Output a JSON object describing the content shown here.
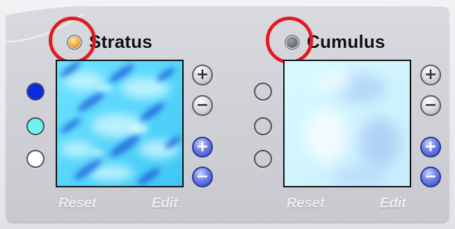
{
  "panels": [
    {
      "title": "Stratus",
      "status_led": {
        "state": "on",
        "color": "#f2a93b"
      },
      "highlighted": true,
      "preview": {
        "texture": "blue-stratus-clouds"
      },
      "swatches": [
        {
          "color": "#0a2be0"
        },
        {
          "color": "#6ff2ee"
        },
        {
          "color": "#ffffff"
        }
      ],
      "buttons": {
        "plus_top": "+",
        "minus_top": "−",
        "plus_bottom": "+",
        "minus_bottom": "−"
      },
      "links": {
        "reset": "Reset",
        "edit": "Edit"
      }
    },
    {
      "title": "Cumulus",
      "status_led": {
        "state": "off",
        "color": "#6f727a"
      },
      "highlighted": true,
      "preview": {
        "texture": "pale-cumulus-clouds"
      },
      "swatches": [
        {
          "color": ""
        },
        {
          "color": ""
        },
        {
          "color": ""
        }
      ],
      "buttons": {
        "plus_top": "+",
        "minus_top": "−",
        "plus_bottom": "+",
        "minus_bottom": "−"
      },
      "links": {
        "reset": "Reset",
        "edit": "Edit"
      }
    }
  ],
  "highlight_color": "#e11b22"
}
